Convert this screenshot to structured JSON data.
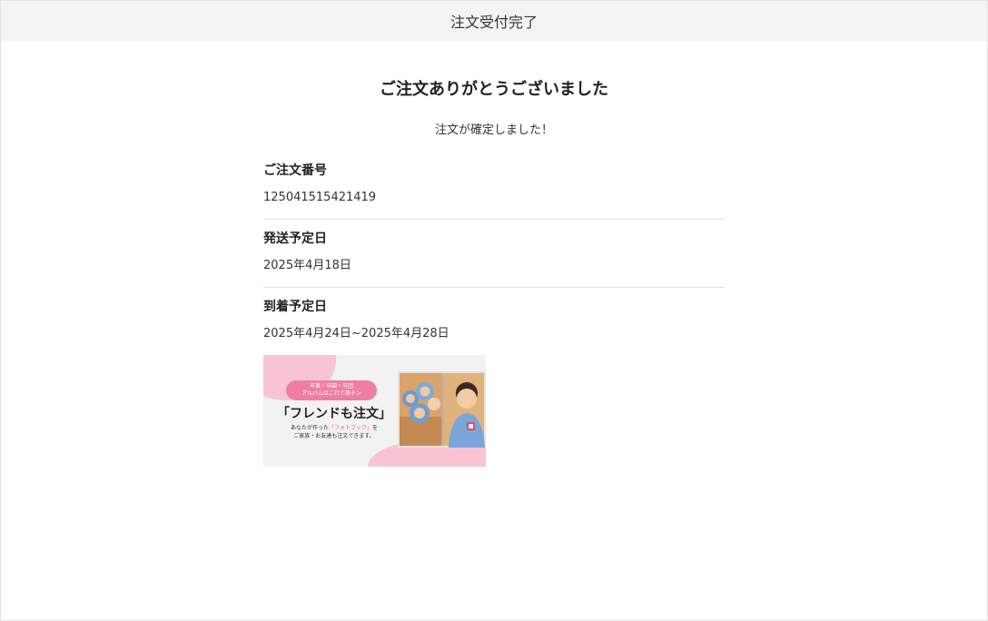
{
  "header": {
    "title": "注文受付完了"
  },
  "main": {
    "thanks_heading": "ご注文ありがとうございました",
    "confirm_message": "注文が確定しました！",
    "sections": [
      {
        "label": "ご注文番号",
        "value": "125041515421419"
      },
      {
        "label": "発送予定日",
        "value": "2025年4月18日"
      },
      {
        "label": "到着予定日",
        "value": "2025年4月24日~2025年4月28日"
      }
    ]
  },
  "banner": {
    "pill_line1": "卒業・卒園・卒団",
    "pill_line2": "アルバムはこれで楽チン",
    "headline": "「フレンドも注文」",
    "sub_line1_pre": "あなたが作った",
    "sub_line1_highlight": "「フォトブック」",
    "sub_line1_post": "を",
    "sub_line2": "ご家族・お友達も注文できます。",
    "colors": {
      "accent_pink": "#ee7ea3",
      "blob_pink": "#f8c4d3"
    }
  }
}
